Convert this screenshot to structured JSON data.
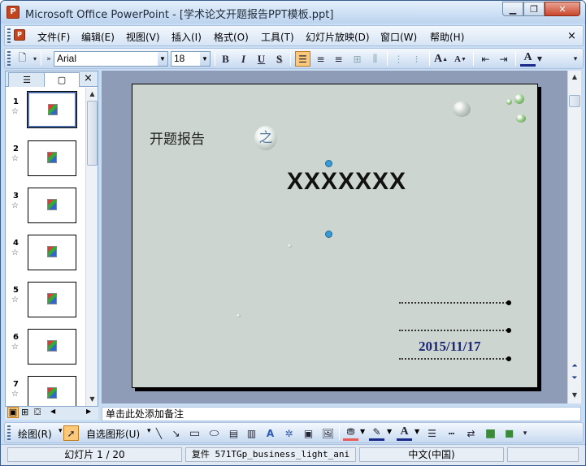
{
  "window": {
    "title": "Microsoft Office PowerPoint - [学术论文开题报告PPT模板.ppt]",
    "app_icon": "P",
    "min_icon": "minimize-icon",
    "max_icon": "restore-icon",
    "close_icon": "close-icon"
  },
  "menu": {
    "items": [
      "文件(F)",
      "编辑(E)",
      "视图(V)",
      "插入(I)",
      "格式(O)",
      "工具(T)",
      "幻灯片放映(D)",
      "窗口(W)",
      "帮助(H)"
    ],
    "doc_close": "×"
  },
  "toolbar": {
    "font_name": "Arial",
    "font_size": "18",
    "bold": "B",
    "italic": "I",
    "underline": "U",
    "shadow": "S",
    "grow_font": "A",
    "shrink_font": "A",
    "font_color": "A"
  },
  "pane": {
    "close": "×",
    "slides": [
      {
        "num": "1"
      },
      {
        "num": "2"
      },
      {
        "num": "3"
      },
      {
        "num": "4"
      },
      {
        "num": "5"
      },
      {
        "num": "6"
      },
      {
        "num": "7"
      }
    ]
  },
  "slide": {
    "heading": "开题报告",
    "title": "XXXXXXX",
    "zhi": "之",
    "date": "2015/11/17"
  },
  "notes": {
    "placeholder": "单击此处添加备注"
  },
  "drawbar": {
    "draw_label": "绘图(R)",
    "autoshape_label": "自选图形(U)"
  },
  "status": {
    "slide_indicator": "幻灯片 1 / 20",
    "design": "复件 571TGp_business_light_ani",
    "language": "中文(中国)"
  },
  "colors": {
    "accent": "#fcc97a",
    "date_color": "#1b2672",
    "font_color_bar": "#1a2a8a",
    "fill_color_bar": "#e85b5b"
  }
}
